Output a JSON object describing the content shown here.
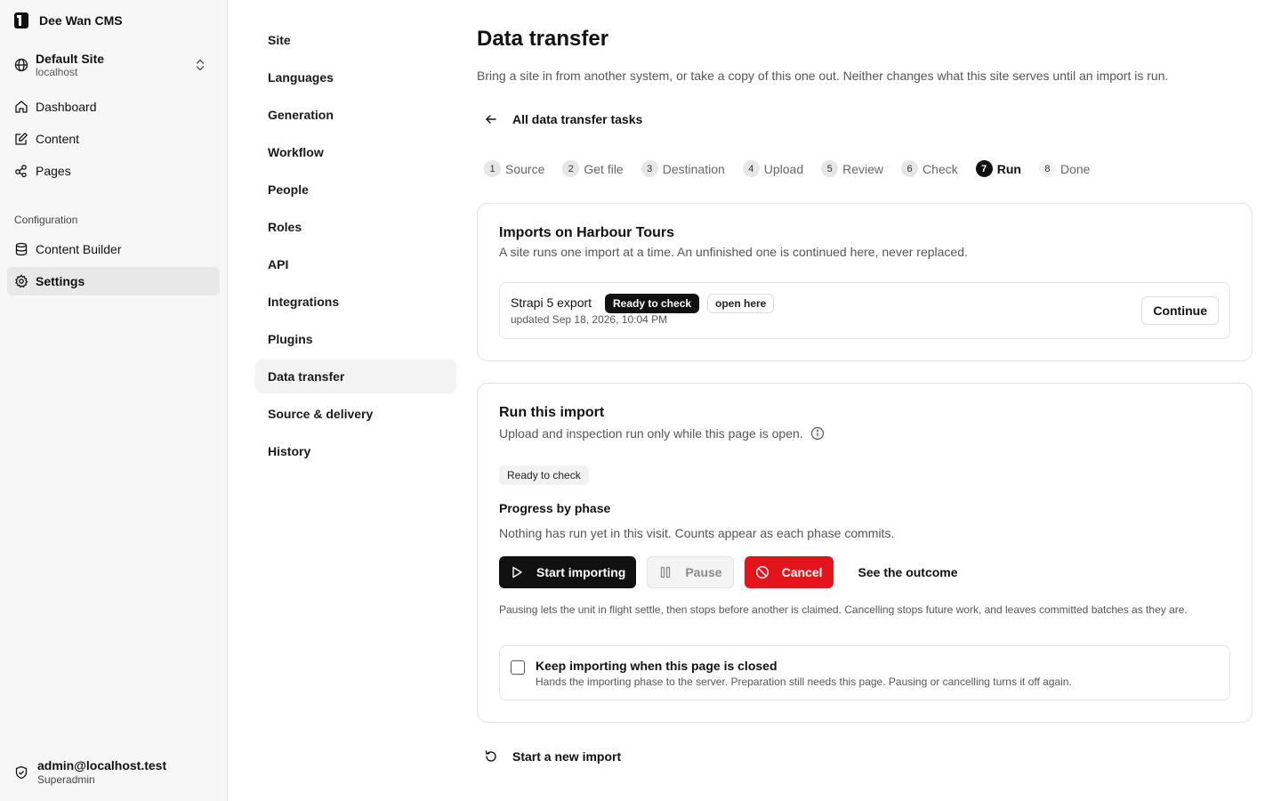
{
  "app": {
    "brand_name": "Dee Wan CMS",
    "site_name": "Default Site",
    "site_host": "localhost"
  },
  "sidebar": {
    "items": [
      {
        "label": "Dashboard",
        "icon": "home-icon"
      },
      {
        "label": "Content",
        "icon": "edit-icon"
      },
      {
        "label": "Pages",
        "icon": "pages-icon"
      }
    ],
    "section_label": "Configuration",
    "config_items": [
      {
        "label": "Content Builder",
        "icon": "database-icon"
      },
      {
        "label": "Settings",
        "icon": "gear-icon",
        "active": true
      }
    ],
    "user": {
      "email": "admin@localhost.test",
      "role": "Superadmin"
    }
  },
  "settings_nav": {
    "items": [
      "Site",
      "Languages",
      "Generation",
      "Workflow",
      "People",
      "Roles",
      "API",
      "Integrations",
      "Plugins",
      "Data transfer",
      "Source & delivery",
      "History"
    ],
    "active": "Data transfer"
  },
  "page": {
    "title": "Data transfer",
    "description": "Bring a site in from another system, or take a copy of this one out. Neither changes what this site serves until an import is run.",
    "back_label": "All data transfer tasks"
  },
  "steps": [
    {
      "num": "1",
      "label": "Source"
    },
    {
      "num": "2",
      "label": "Get file"
    },
    {
      "num": "3",
      "label": "Destination"
    },
    {
      "num": "4",
      "label": "Upload"
    },
    {
      "num": "5",
      "label": "Review"
    },
    {
      "num": "6",
      "label": "Check"
    },
    {
      "num": "7",
      "label": "Run"
    },
    {
      "num": "8",
      "label": "Done"
    }
  ],
  "current_step": "7",
  "imports": {
    "title": "Imports on Harbour Tours",
    "subtitle": "A site runs one import at a time. An unfinished one is continued here, never replaced.",
    "row": {
      "name": "Strapi 5 export",
      "status_badge": "Ready to check",
      "location_badge": "open here",
      "updated": "updated Sep 18, 2026, 10:04 PM",
      "continue_label": "Continue"
    }
  },
  "run": {
    "title": "Run this import",
    "subtitle": "Upload and inspection run only while this page is open.",
    "status": "Ready to check",
    "phase_title": "Progress by phase",
    "phase_note": "Nothing has run yet in this visit. Counts appear as each phase commits.",
    "start_label": "Start importing",
    "pause_label": "Pause",
    "cancel_label": "Cancel",
    "outcome_label": "See the outcome",
    "help": "Pausing lets the unit in flight settle, then stops before another is claimed. Cancelling stops future work, and leaves committed batches as they are.",
    "keep_label": "Keep importing when this page is closed",
    "keep_help": "Hands the importing phase to the server. Preparation still needs this page. Pausing or cancelling turns it off again.",
    "keep_checked": false
  },
  "new_import_label": "Start a new import",
  "colors": {
    "accent": "#111111",
    "danger": "#e5141b",
    "muted_bg": "#f4f4f4"
  }
}
